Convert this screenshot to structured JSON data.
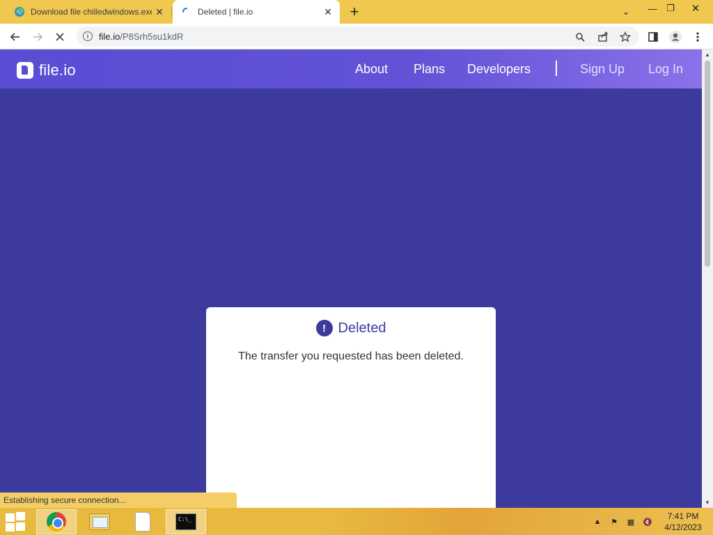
{
  "tabs": [
    {
      "title": "Download file chilledwindows.exe",
      "icon": "edge-icon",
      "active": false
    },
    {
      "title": "Deleted | file.io",
      "icon": "loading-spinner-icon",
      "active": true
    }
  ],
  "toolbar": {
    "url_host": "file.io",
    "url_path": "/P8Srh5su1kdR"
  },
  "site": {
    "logo_text": "file.io",
    "nav": {
      "about": "About",
      "plans": "Plans",
      "developers": "Developers",
      "signup": "Sign Up",
      "login": "Log In"
    },
    "accent_color": "#3d3a9d"
  },
  "card": {
    "title": "Deleted",
    "message": "The transfer you requested has been deleted."
  },
  "status_text": "Establishing secure connection...",
  "clock": {
    "time": "7:41 PM",
    "date": "4/12/2023"
  }
}
